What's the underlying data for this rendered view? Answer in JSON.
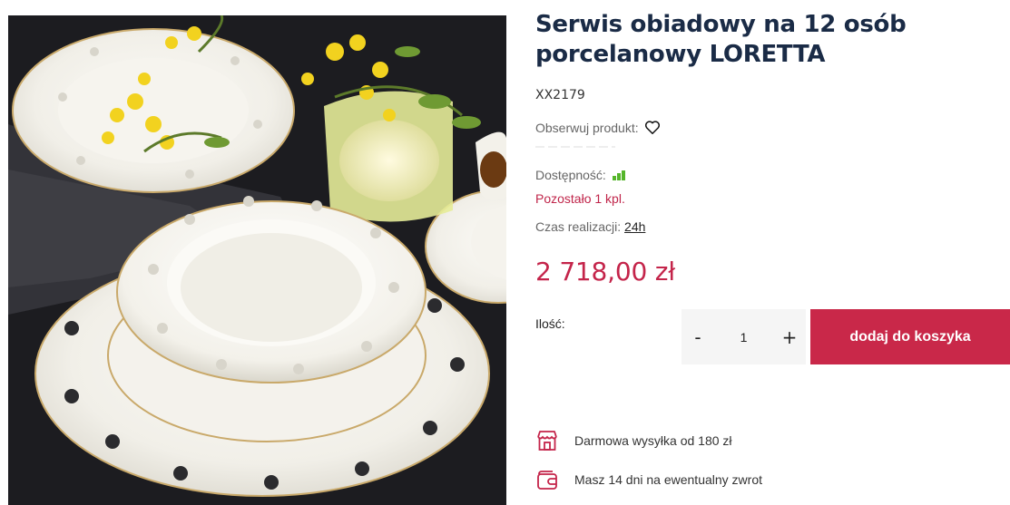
{
  "product": {
    "title_line1": "Serwis obiadowy na 12 osób",
    "title_line2": "porcelanowy LORETTA",
    "sku": "XX2179",
    "watch_label": "Obserwuj produkt:",
    "availability_label": "Dostępność:",
    "availability_level": "3 of 3 bars",
    "stock_text": "Pozostało 1 kpl.",
    "realization_label": "Czas realizacji:",
    "realization_value": "24h",
    "price": "2 718,00 zł"
  },
  "cart": {
    "quantity_label": "Ilość:",
    "quantity_value": "1",
    "minus_label": "-",
    "plus_label": "+",
    "add_to_cart_label": "dodaj do koszyka"
  },
  "perks": [
    {
      "icon": "store-icon",
      "text": "Darmowa wysyłka od 180 zł"
    },
    {
      "icon": "wallet-icon",
      "text": "Masz 14 dni na ewentualny zwrot"
    }
  ],
  "colors": {
    "title": "#1a2b46",
    "price": "#c4244a",
    "accent": "#c92849",
    "availability": "#55b52a"
  }
}
